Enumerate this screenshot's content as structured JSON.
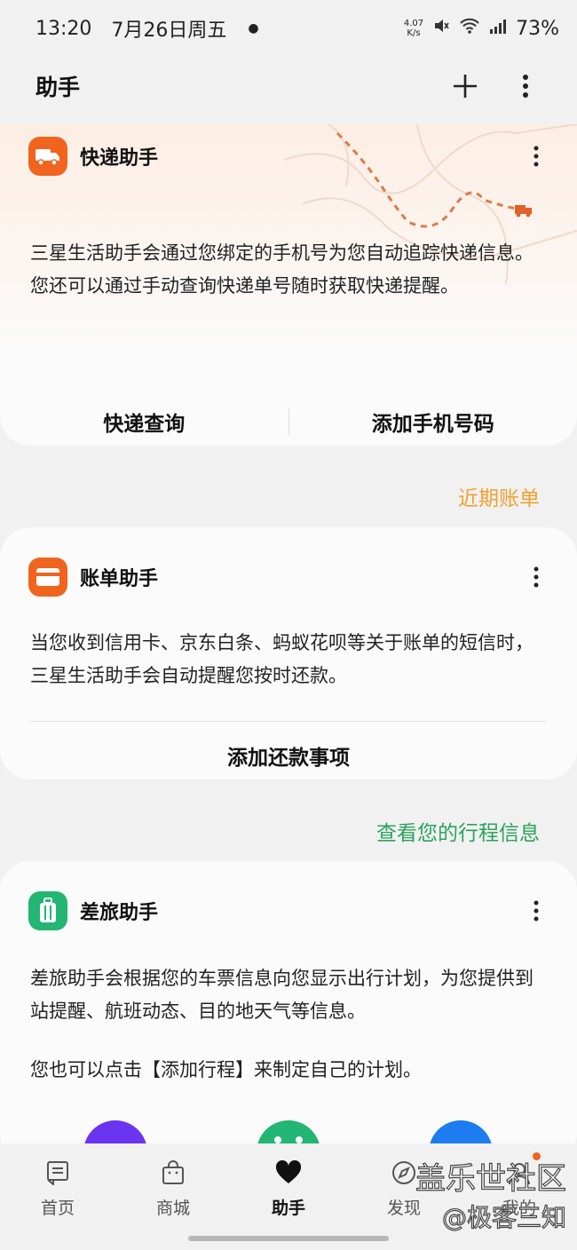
{
  "status_bar": {
    "time": "13:20",
    "date": "7月26日周五",
    "net_speed_value": "4.07",
    "net_speed_unit": "K/s",
    "battery": "73%"
  },
  "app_bar": {
    "title": "助手"
  },
  "express_card": {
    "title": "快递助手",
    "description": "三星生活助手会通过您绑定的手机号为您自动追踪快递信息。您还可以通过手动查询快递单号随时获取快递提醒。",
    "query_button": "快递查询",
    "add_phone_button": "添加手机号码",
    "icon_color": "#f0641e"
  },
  "bill_section_link": "近期账单",
  "bill_card": {
    "title": "账单助手",
    "description": "当您收到信用卡、京东白条、蚂蚁花呗等关于账单的短信时，三星生活助手会自动提醒您按时还款。",
    "add_button": "添加还款事项",
    "icon_color": "#f0641e"
  },
  "travel_section_link": "查看您的行程信息",
  "travel_card": {
    "title": "差旅助手",
    "description": "差旅助手会根据您的车票信息向您显示出行计划，为您提供到站提醒、航班动态、目的地天气等信息。",
    "description2": "您也可以点击【添加行程】来制定自己的计划。",
    "icon_color": "#22b573"
  },
  "bottom_nav": {
    "items": [
      {
        "label": "首页",
        "icon": "home-icon"
      },
      {
        "label": "商城",
        "icon": "shop-bag-icon"
      },
      {
        "label": "助手",
        "icon": "heart-icon"
      },
      {
        "label": "发现",
        "icon": "discover-icon"
      },
      {
        "label": "我的",
        "icon": "profile-icon"
      }
    ]
  },
  "watermark": {
    "line1": "盖乐世社区",
    "line2": "@极客三知"
  },
  "colors": {
    "accent_orange": "#f0a030",
    "accent_green": "#2ba35c",
    "notification_dot": "#f0641e"
  }
}
